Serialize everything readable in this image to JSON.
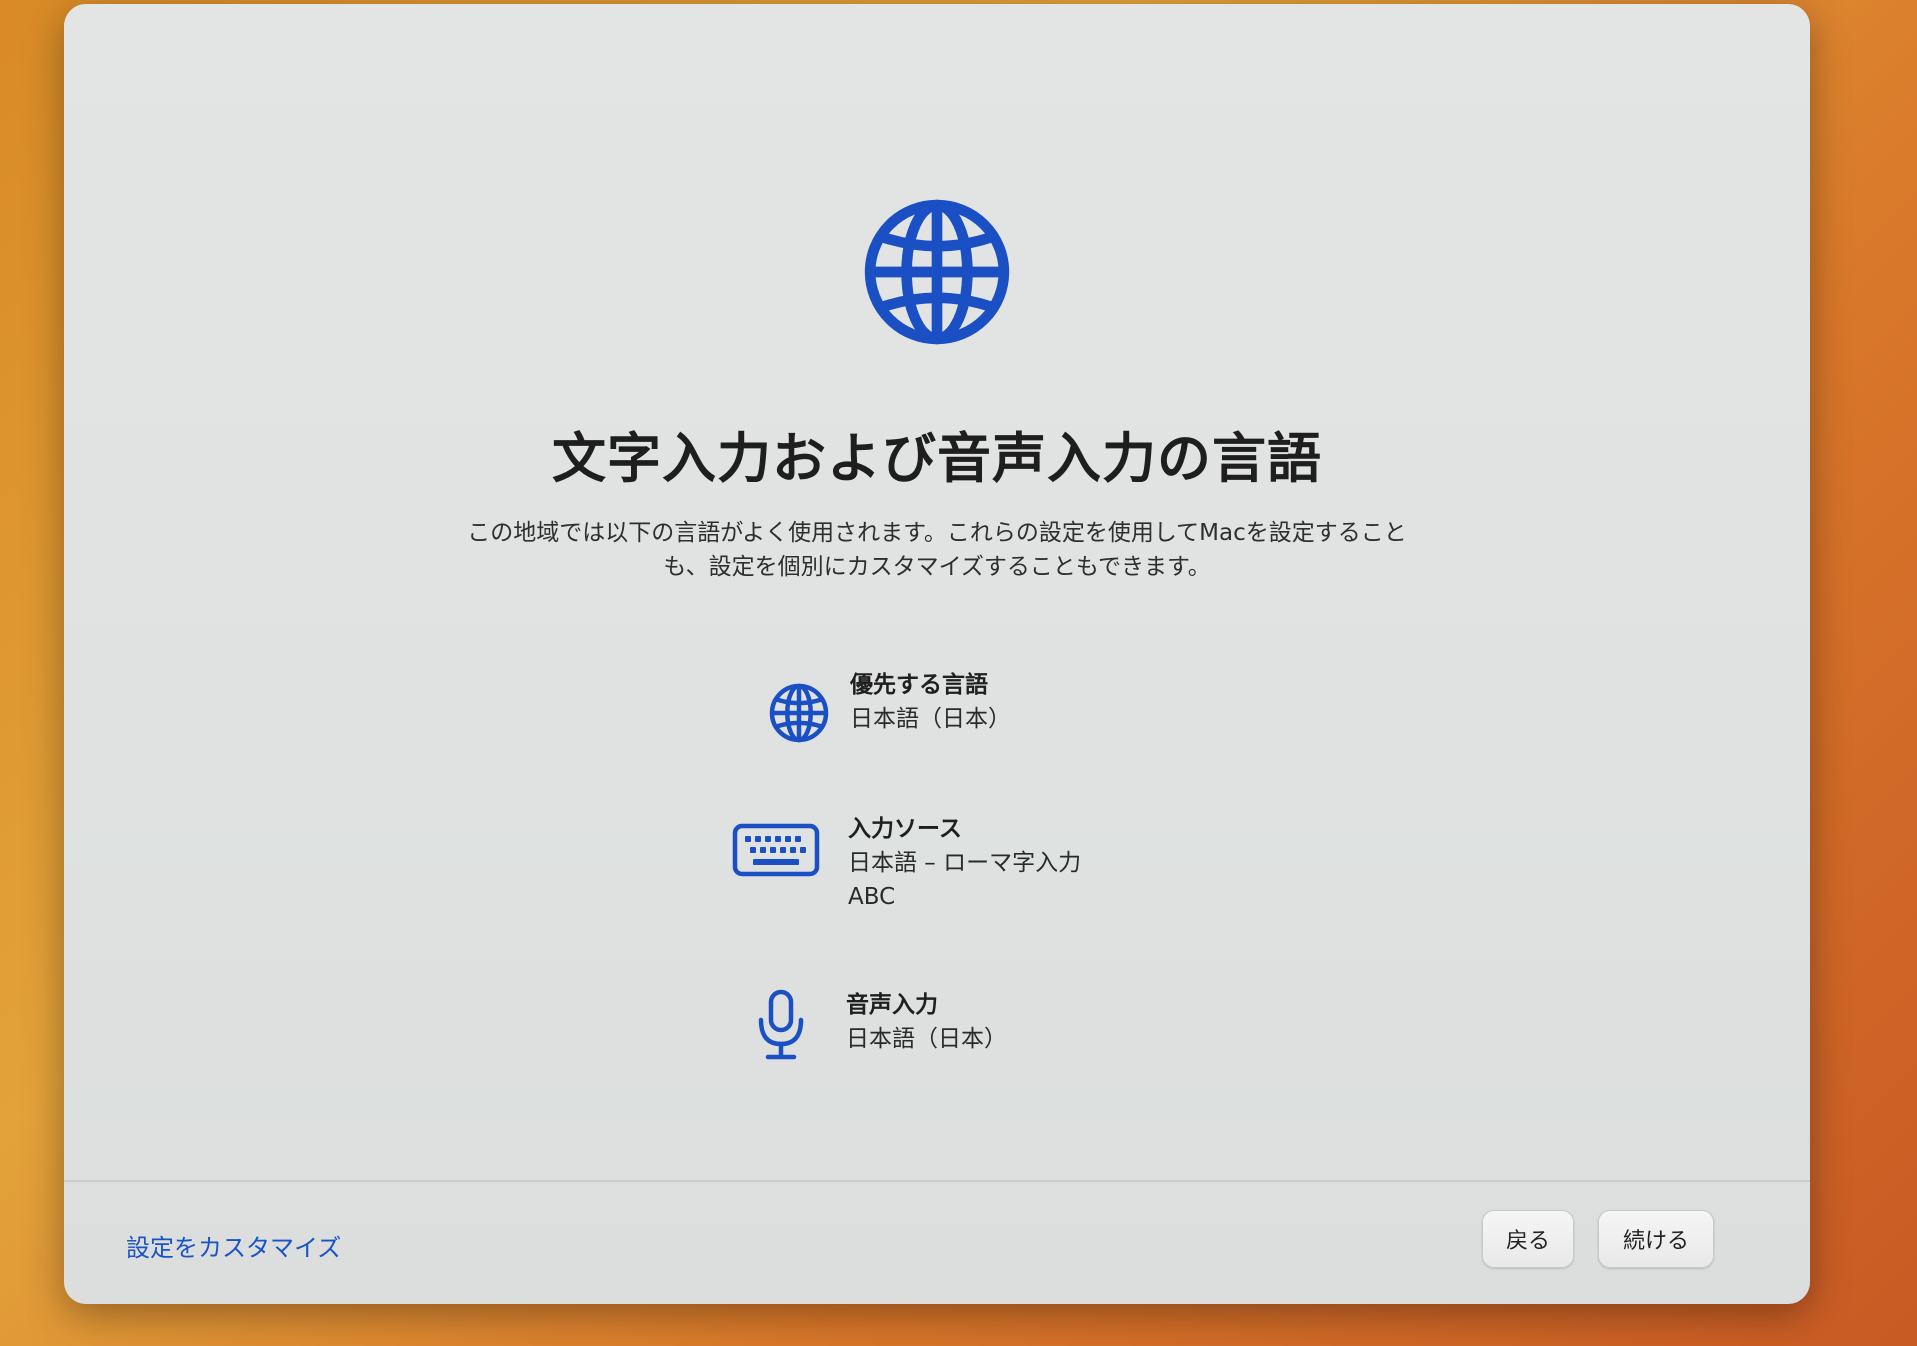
{
  "colors": {
    "accent": "#1a54c4",
    "icon_blue": "#1b4fc4",
    "window_bg": "#e1e3e2"
  },
  "hero": {
    "icon": "globe-icon"
  },
  "title": "文字入力および音声入力の言語",
  "description": "この地域では以下の言語がよく使用されます。これらの設定を使用してMacを設定することも、設定を個別にカスタマイズすることもできます。",
  "settings": [
    {
      "icon": "globe-icon",
      "label": "優先する言語",
      "values": [
        "日本語（日本）"
      ]
    },
    {
      "icon": "keyboard-icon",
      "label": "入力ソース",
      "values": [
        "日本語 – ローマ字入力",
        "ABC"
      ]
    },
    {
      "icon": "microphone-icon",
      "label": "音声入力",
      "values": [
        "日本語（日本）"
      ]
    }
  ],
  "footer": {
    "customize_link": "設定をカスタマイズ",
    "back_label": "戻る",
    "continue_label": "続ける"
  }
}
